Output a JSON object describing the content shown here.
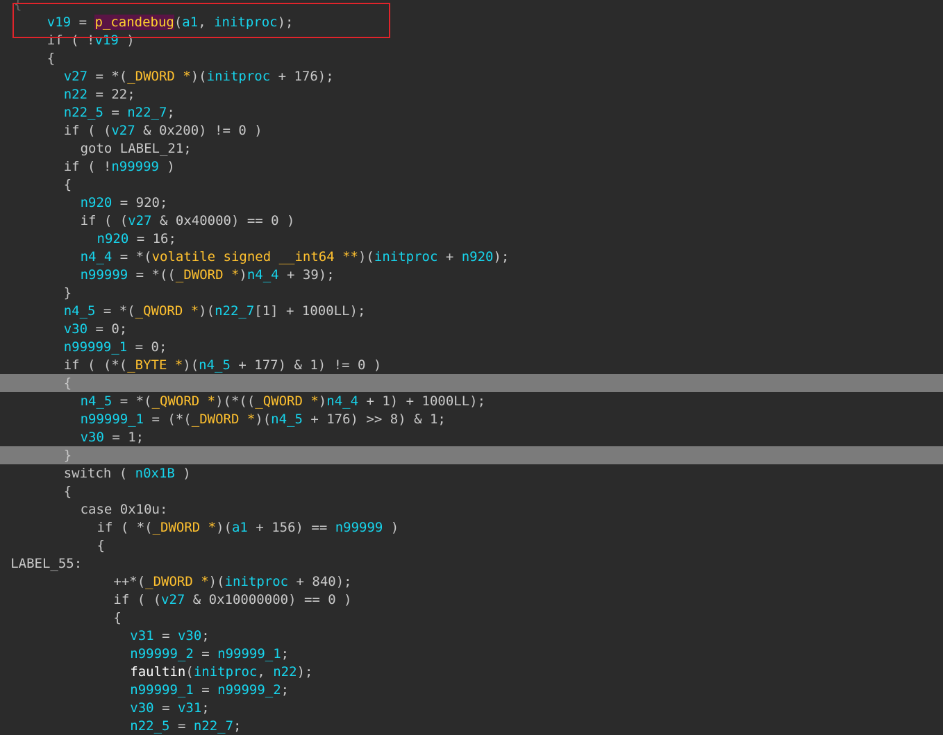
{
  "editor": {
    "colors": {
      "background": "#2b2b2b",
      "plain": "#c9c9c9",
      "variable": "#17d4ec",
      "type": "#ffc12f",
      "function": "#ffffff",
      "highlighted_line": "#7b7b7b",
      "selection_border": "#e0242b"
    },
    "lines": [
      {
        "indent": 0,
        "highlight": false,
        "tokens": [
          {
            "t": "{",
            "c": "ghost"
          }
        ]
      },
      {
        "indent": 2,
        "highlight": false,
        "tokens": [
          {
            "t": "v19",
            "c": "var"
          },
          {
            "t": " = ",
            "c": "plain"
          },
          {
            "t": "p_candebug",
            "c": "fn-hl"
          },
          {
            "t": "(",
            "c": "plain"
          },
          {
            "t": "a1",
            "c": "var"
          },
          {
            "t": ", ",
            "c": "plain"
          },
          {
            "t": "initproc",
            "c": "var"
          },
          {
            "t": ");",
            "c": "plain"
          }
        ]
      },
      {
        "indent": 2,
        "highlight": false,
        "tokens": [
          {
            "t": "if ( !",
            "c": "plain"
          },
          {
            "t": "v19",
            "c": "var"
          },
          {
            "t": " )",
            "c": "plain"
          }
        ]
      },
      {
        "indent": 2,
        "highlight": false,
        "tokens": [
          {
            "t": "{",
            "c": "plain"
          }
        ]
      },
      {
        "indent": 3,
        "highlight": false,
        "tokens": [
          {
            "t": "v27",
            "c": "var"
          },
          {
            "t": " = *(",
            "c": "plain"
          },
          {
            "t": "_DWORD *",
            "c": "type"
          },
          {
            "t": ")(",
            "c": "plain"
          },
          {
            "t": "initproc",
            "c": "var"
          },
          {
            "t": " + 176);",
            "c": "plain"
          }
        ]
      },
      {
        "indent": 3,
        "highlight": false,
        "tokens": [
          {
            "t": "n22",
            "c": "var"
          },
          {
            "t": " = 22;",
            "c": "plain"
          }
        ]
      },
      {
        "indent": 3,
        "highlight": false,
        "tokens": [
          {
            "t": "n22_5",
            "c": "var"
          },
          {
            "t": " = ",
            "c": "plain"
          },
          {
            "t": "n22_7",
            "c": "var"
          },
          {
            "t": ";",
            "c": "plain"
          }
        ]
      },
      {
        "indent": 3,
        "highlight": false,
        "tokens": [
          {
            "t": "if ( (",
            "c": "plain"
          },
          {
            "t": "v27",
            "c": "var"
          },
          {
            "t": " & 0x200) != 0 )",
            "c": "plain"
          }
        ]
      },
      {
        "indent": 4,
        "highlight": false,
        "tokens": [
          {
            "t": "goto LABEL_21;",
            "c": "plain"
          }
        ]
      },
      {
        "indent": 3,
        "highlight": false,
        "tokens": [
          {
            "t": "if ( !",
            "c": "plain"
          },
          {
            "t": "n99999",
            "c": "var"
          },
          {
            "t": " )",
            "c": "plain"
          }
        ]
      },
      {
        "indent": 3,
        "highlight": false,
        "tokens": [
          {
            "t": "{",
            "c": "plain"
          }
        ]
      },
      {
        "indent": 4,
        "highlight": false,
        "tokens": [
          {
            "t": "n920",
            "c": "var"
          },
          {
            "t": " = 920;",
            "c": "plain"
          }
        ]
      },
      {
        "indent": 4,
        "highlight": false,
        "tokens": [
          {
            "t": "if ( (",
            "c": "plain"
          },
          {
            "t": "v27",
            "c": "var"
          },
          {
            "t": " & 0x40000) == 0 )",
            "c": "plain"
          }
        ]
      },
      {
        "indent": 5,
        "highlight": false,
        "tokens": [
          {
            "t": "n920",
            "c": "var"
          },
          {
            "t": " = 16;",
            "c": "plain"
          }
        ]
      },
      {
        "indent": 4,
        "highlight": false,
        "tokens": [
          {
            "t": "n4_4",
            "c": "var"
          },
          {
            "t": " = *(",
            "c": "plain"
          },
          {
            "t": "volatile signed __int64 **",
            "c": "type"
          },
          {
            "t": ")(",
            "c": "plain"
          },
          {
            "t": "initproc",
            "c": "var"
          },
          {
            "t": " + ",
            "c": "plain"
          },
          {
            "t": "n920",
            "c": "var"
          },
          {
            "t": ");",
            "c": "plain"
          }
        ]
      },
      {
        "indent": 4,
        "highlight": false,
        "tokens": [
          {
            "t": "n99999",
            "c": "var"
          },
          {
            "t": " = *((",
            "c": "plain"
          },
          {
            "t": "_DWORD *",
            "c": "type"
          },
          {
            "t": ")",
            "c": "plain"
          },
          {
            "t": "n4_4",
            "c": "var"
          },
          {
            "t": " + 39);",
            "c": "plain"
          }
        ]
      },
      {
        "indent": 3,
        "highlight": false,
        "tokens": [
          {
            "t": "}",
            "c": "plain"
          }
        ]
      },
      {
        "indent": 3,
        "highlight": false,
        "tokens": [
          {
            "t": "n4_5",
            "c": "var"
          },
          {
            "t": " = *(",
            "c": "plain"
          },
          {
            "t": "_QWORD *",
            "c": "type"
          },
          {
            "t": ")(",
            "c": "plain"
          },
          {
            "t": "n22_7",
            "c": "var"
          },
          {
            "t": "[1] + 1000LL);",
            "c": "plain"
          }
        ]
      },
      {
        "indent": 3,
        "highlight": false,
        "tokens": [
          {
            "t": "v30",
            "c": "var"
          },
          {
            "t": " = 0;",
            "c": "plain"
          }
        ]
      },
      {
        "indent": 3,
        "highlight": false,
        "tokens": [
          {
            "t": "n99999_1",
            "c": "var"
          },
          {
            "t": " = 0;",
            "c": "plain"
          }
        ]
      },
      {
        "indent": 3,
        "highlight": false,
        "tokens": [
          {
            "t": "if ( (*(",
            "c": "plain"
          },
          {
            "t": "_BYTE *",
            "c": "type"
          },
          {
            "t": ")(",
            "c": "plain"
          },
          {
            "t": "n4_5",
            "c": "var"
          },
          {
            "t": " + 177) & 1) != 0 )",
            "c": "plain"
          }
        ]
      },
      {
        "indent": 3,
        "highlight": true,
        "tokens": [
          {
            "t": "{",
            "c": "plain"
          }
        ]
      },
      {
        "indent": 4,
        "highlight": false,
        "tokens": [
          {
            "t": "n4_5",
            "c": "var"
          },
          {
            "t": " = *(",
            "c": "plain"
          },
          {
            "t": "_QWORD *",
            "c": "type"
          },
          {
            "t": ")(*((",
            "c": "plain"
          },
          {
            "t": "_QWORD *",
            "c": "type"
          },
          {
            "t": ")",
            "c": "plain"
          },
          {
            "t": "n4_4",
            "c": "var"
          },
          {
            "t": " + 1) + 1000LL);",
            "c": "plain"
          }
        ]
      },
      {
        "indent": 4,
        "highlight": false,
        "tokens": [
          {
            "t": "n99999_1",
            "c": "var"
          },
          {
            "t": " = (*(",
            "c": "plain"
          },
          {
            "t": "_DWORD *",
            "c": "type"
          },
          {
            "t": ")(",
            "c": "plain"
          },
          {
            "t": "n4_5",
            "c": "var"
          },
          {
            "t": " + 176) >> 8) & 1;",
            "c": "plain"
          }
        ]
      },
      {
        "indent": 4,
        "highlight": false,
        "tokens": [
          {
            "t": "v30",
            "c": "var"
          },
          {
            "t": " = 1;",
            "c": "plain"
          }
        ]
      },
      {
        "indent": 3,
        "highlight": true,
        "tokens": [
          {
            "t": "}",
            "c": "plain"
          }
        ]
      },
      {
        "indent": 3,
        "highlight": false,
        "tokens": [
          {
            "t": "switch ( ",
            "c": "plain"
          },
          {
            "t": "n0x1B",
            "c": "var"
          },
          {
            "t": " )",
            "c": "plain"
          }
        ]
      },
      {
        "indent": 3,
        "highlight": false,
        "tokens": [
          {
            "t": "{",
            "c": "plain"
          }
        ]
      },
      {
        "indent": 4,
        "highlight": false,
        "tokens": [
          {
            "t": "case 0x10u:",
            "c": "plain"
          }
        ]
      },
      {
        "indent": 5,
        "highlight": false,
        "tokens": [
          {
            "t": "if ( *(",
            "c": "plain"
          },
          {
            "t": "_DWORD *",
            "c": "type"
          },
          {
            "t": ")(",
            "c": "plain"
          },
          {
            "t": "a1",
            "c": "var"
          },
          {
            "t": " + 156) == ",
            "c": "plain"
          },
          {
            "t": "n99999",
            "c": "var"
          },
          {
            "t": " )",
            "c": "plain"
          }
        ]
      },
      {
        "indent": 5,
        "highlight": false,
        "tokens": [
          {
            "t": "{",
            "c": "plain"
          }
        ]
      },
      {
        "indent": -0.2,
        "highlight": false,
        "tokens": [
          {
            "t": "LABEL_55:",
            "c": "plain"
          }
        ]
      },
      {
        "indent": 6,
        "highlight": false,
        "tokens": [
          {
            "t": "++*(",
            "c": "plain"
          },
          {
            "t": "_DWORD *",
            "c": "type"
          },
          {
            "t": ")(",
            "c": "plain"
          },
          {
            "t": "initproc",
            "c": "var"
          },
          {
            "t": " + 840);",
            "c": "plain"
          }
        ]
      },
      {
        "indent": 6,
        "highlight": false,
        "tokens": [
          {
            "t": "if ( (",
            "c": "plain"
          },
          {
            "t": "v27",
            "c": "var"
          },
          {
            "t": " & 0x10000000) == 0 )",
            "c": "plain"
          }
        ]
      },
      {
        "indent": 6,
        "highlight": false,
        "tokens": [
          {
            "t": "{",
            "c": "plain"
          }
        ]
      },
      {
        "indent": 7,
        "highlight": false,
        "tokens": [
          {
            "t": "v31",
            "c": "var"
          },
          {
            "t": " = ",
            "c": "plain"
          },
          {
            "t": "v30",
            "c": "var"
          },
          {
            "t": ";",
            "c": "plain"
          }
        ]
      },
      {
        "indent": 7,
        "highlight": false,
        "tokens": [
          {
            "t": "n99999_2",
            "c": "var"
          },
          {
            "t": " = ",
            "c": "plain"
          },
          {
            "t": "n99999_1",
            "c": "var"
          },
          {
            "t": ";",
            "c": "plain"
          }
        ]
      },
      {
        "indent": 7,
        "highlight": false,
        "tokens": [
          {
            "t": "faultin",
            "c": "fn"
          },
          {
            "t": "(",
            "c": "plain"
          },
          {
            "t": "initproc",
            "c": "var"
          },
          {
            "t": ", ",
            "c": "plain"
          },
          {
            "t": "n22",
            "c": "var"
          },
          {
            "t": ");",
            "c": "plain"
          }
        ]
      },
      {
        "indent": 7,
        "highlight": false,
        "tokens": [
          {
            "t": "n99999_1",
            "c": "var"
          },
          {
            "t": " = ",
            "c": "plain"
          },
          {
            "t": "n99999_2",
            "c": "var"
          },
          {
            "t": ";",
            "c": "plain"
          }
        ]
      },
      {
        "indent": 7,
        "highlight": false,
        "tokens": [
          {
            "t": "v30",
            "c": "var"
          },
          {
            "t": " = ",
            "c": "plain"
          },
          {
            "t": "v31",
            "c": "var"
          },
          {
            "t": ";",
            "c": "plain"
          }
        ]
      },
      {
        "indent": 7,
        "highlight": false,
        "tokens": [
          {
            "t": "n22_5",
            "c": "var"
          },
          {
            "t": " = ",
            "c": "plain"
          },
          {
            "t": "n22_7",
            "c": "var"
          },
          {
            "t": ";",
            "c": "plain"
          }
        ]
      }
    ]
  }
}
